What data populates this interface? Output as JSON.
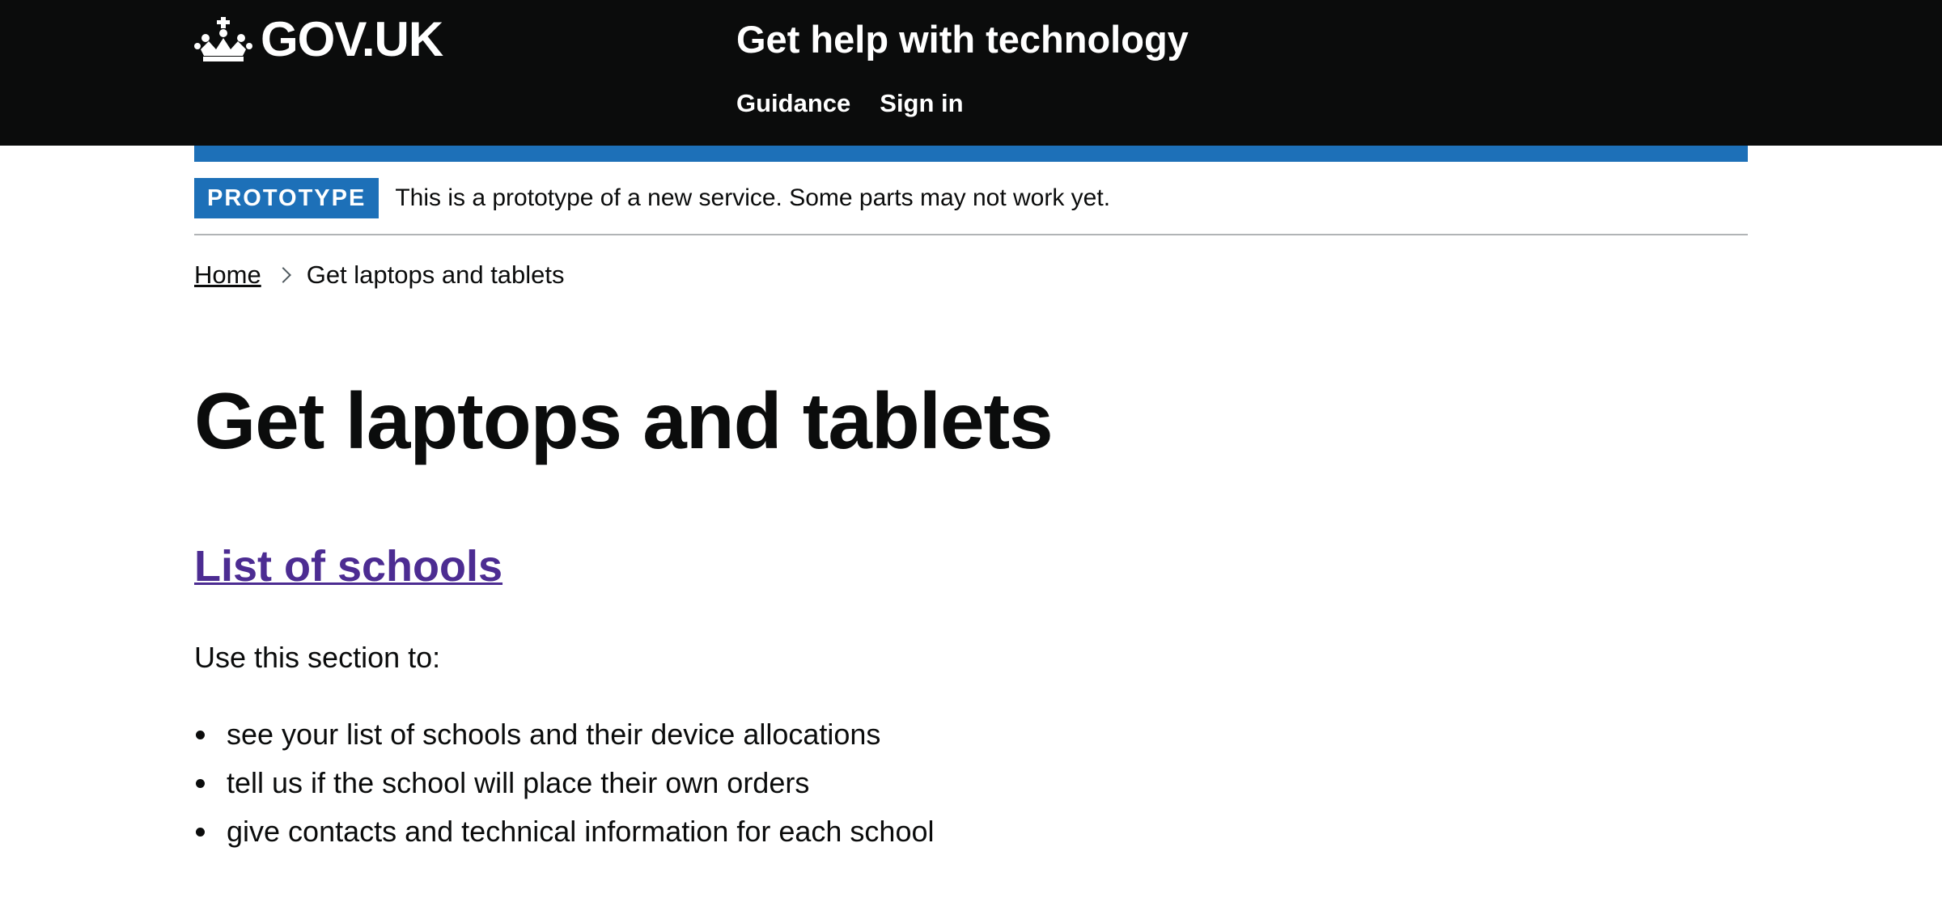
{
  "header": {
    "logo_text": "GOV.UK",
    "logo_icon": "crown-icon",
    "service_name": "Get help with technology",
    "nav": [
      {
        "label": "Guidance"
      },
      {
        "label": "Sign in"
      }
    ]
  },
  "phase_banner": {
    "tag": "PROTOTYPE",
    "text": "This is a prototype of a new service. Some parts may not work yet."
  },
  "breadcrumbs": {
    "home": "Home",
    "current": "Get laptops and tablets",
    "separator_icon": "chevron-right-icon"
  },
  "main": {
    "title": "Get laptops and tablets",
    "section_link": "List of schools",
    "intro": "Use this section to:",
    "bullets": [
      "see your list of schools and their device allocations",
      "tell us if the school will place their own orders",
      "give contacts and technical information for each school"
    ]
  },
  "colors": {
    "header_bg": "#0b0c0c",
    "accent_blue": "#1d70b8",
    "visited_link": "#4c2c92",
    "text": "#0b0c0c",
    "border": "#b1b4b6"
  }
}
